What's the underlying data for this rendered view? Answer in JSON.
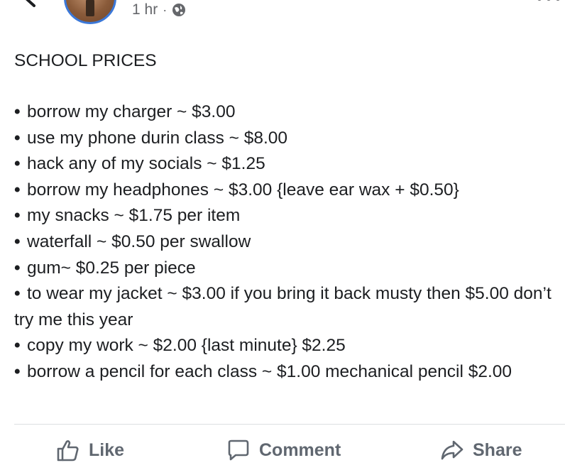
{
  "header": {
    "timestamp": "1 hr",
    "separator": "·",
    "privacy_icon": "globe-icon",
    "back_icon": "back-arrow-icon",
    "more_icon": "more-icon"
  },
  "post": {
    "title": "SCHOOL PRICES",
    "items": [
      "borrow my charger ~ $3.00",
      "use my phone durin class ~ $8.00",
      "hack any of my socials ~ $1.25",
      "borrow my headphones ~ $3.00 {leave ear wax + $0.50}",
      "my snacks ~ $1.75 per item",
      "waterfall ~ $0.50 per swallow",
      "gum~ $0.25 per piece",
      "to wear my jacket ~ $3.00 if you bring it back musty then $5.00 don’t try me this year",
      "copy my work ~ $2.00 {last minute} $2.25",
      "borrow a pencil for each class ~ $1.00 mechanical pencil $2.00"
    ]
  },
  "actions": {
    "like": "Like",
    "comment": "Comment",
    "share": "Share"
  },
  "colors": {
    "text": "#1c1e21",
    "secondary": "#65676b",
    "action": "#606770",
    "avatar_ring": "#3b78d8",
    "divider": "#dddfe2"
  }
}
